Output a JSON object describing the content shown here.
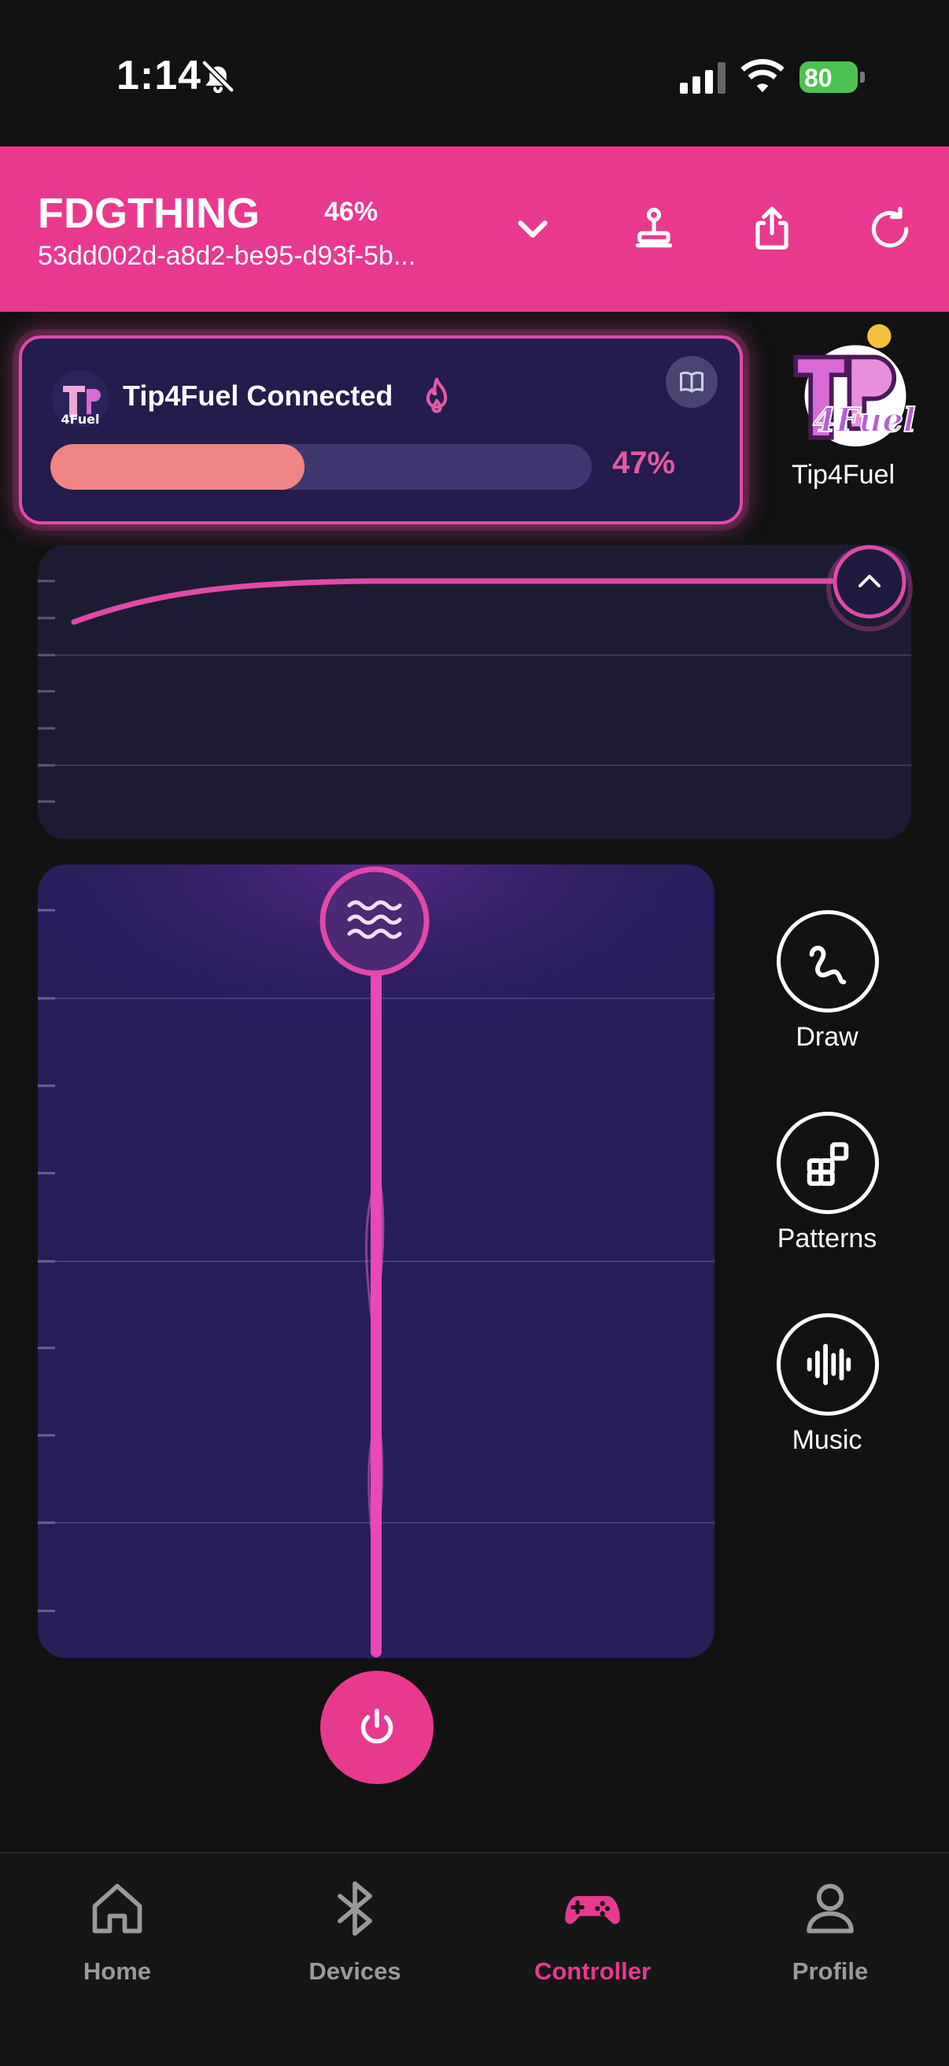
{
  "status_bar": {
    "time": "1:14",
    "battery": "80"
  },
  "header": {
    "device_name": "FDGTHING",
    "device_percent": "46%",
    "device_id": "53dd002d-a8d2-be95-d93f-5b..."
  },
  "tip4fuel": {
    "status_text": "Tip4Fuel Connected",
    "progress": 0.47,
    "progress_label": "47%",
    "brand_label": "Tip4Fuel"
  },
  "side_actions": [
    {
      "label": "Draw"
    },
    {
      "label": "Patterns"
    },
    {
      "label": "Music"
    }
  ],
  "tabbar": {
    "items": [
      {
        "label": "Home",
        "active": false
      },
      {
        "label": "Devices",
        "active": false
      },
      {
        "label": "Controller",
        "active": true
      },
      {
        "label": "Profile",
        "active": false
      }
    ]
  },
  "colors": {
    "accent": "#e8398f",
    "background": "#121212",
    "card_bg": "#241c4d",
    "progress_fill": "#ef8585",
    "inactive_tab": "#9a9a9a"
  },
  "icons": {
    "header": [
      "chevron-down-icon",
      "joystick-icon",
      "share-icon",
      "refresh-icon"
    ],
    "side": [
      "draw-icon",
      "patterns-icon",
      "music-icon"
    ],
    "tabs": [
      "home-icon",
      "bluetooth-icon",
      "gamepad-icon",
      "profile-icon"
    ]
  }
}
